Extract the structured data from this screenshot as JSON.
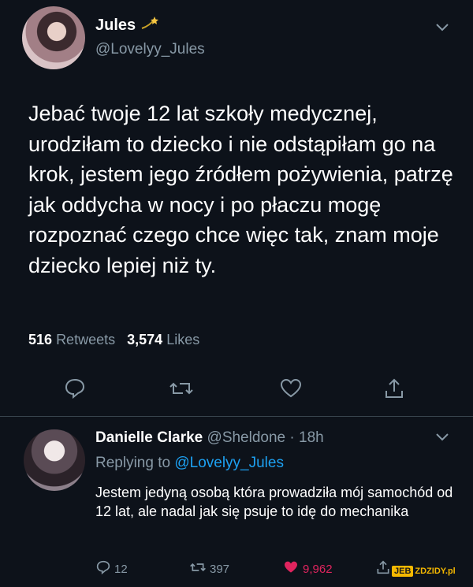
{
  "tweet": {
    "name": "Jules",
    "handle": "@Lovelyy_Jules",
    "text": "Jebać twoje 12 lat szkoły medycznej, urodziłam to dziecko i nie odstąpiłam go na krok, jestem jego źródłem pożywienia, patrzę jak oddycha w nocy i po płaczu mogę rozpoznać czego chce więc tak, znam moje dziecko lepiej niż ty.",
    "retweet_count": "516",
    "retweet_label": "Retweets",
    "like_count": "3,574",
    "like_label": "Likes"
  },
  "reply": {
    "name": "Danielle Clarke",
    "meta": "@Sheldone · 18h",
    "replying_prefix": "Replying to",
    "replying_handle": "@Lovelyy_Jules",
    "text": "Jestem jedyną osobą która prowadziła mój samochód od 12 lat, ale nadal jak się psuje to idę do mechanika",
    "reply_count": "12",
    "retweet_count": "397",
    "like_count": "9,962"
  },
  "watermark": {
    "box": "JEB",
    "rest": "ZDZIDY.pl"
  },
  "colors": {
    "background": "#0d121a",
    "secondary_text": "#8899a6",
    "link": "#1da1f2",
    "like": "#e0245e"
  }
}
